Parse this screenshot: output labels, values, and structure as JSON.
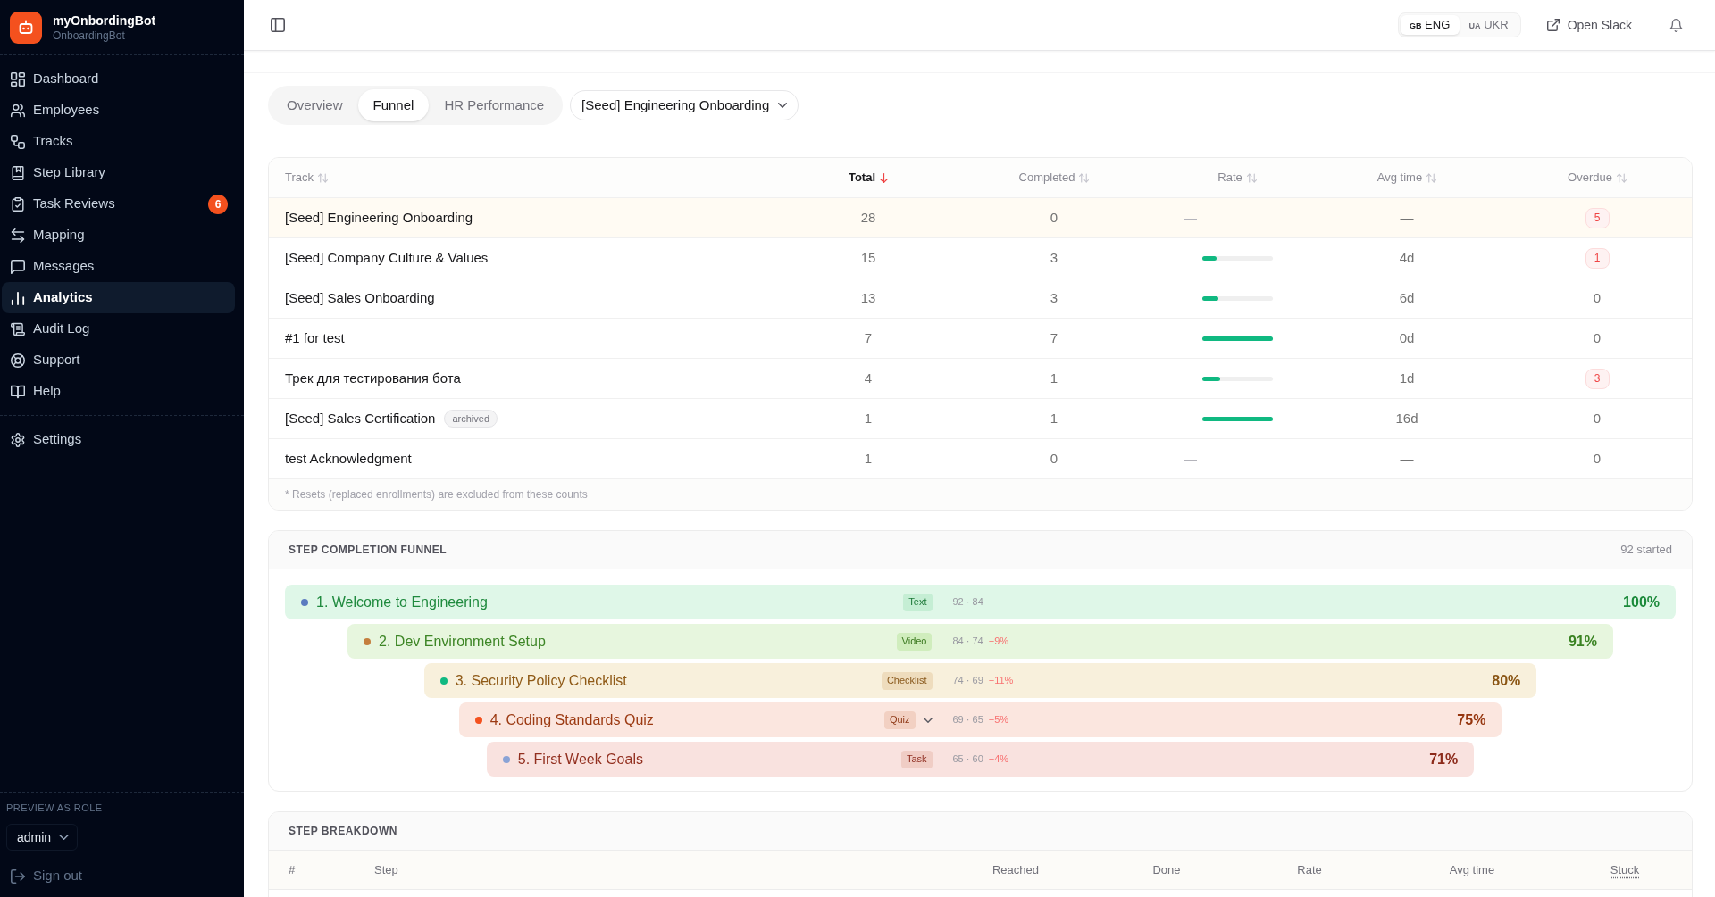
{
  "sidebar": {
    "brand": {
      "name": "myOnbordingBot",
      "subtitle": "OnboardingBot"
    },
    "nav": [
      {
        "label": "Dashboard",
        "selected": false
      },
      {
        "label": "Employees",
        "selected": false
      },
      {
        "label": "Tracks",
        "selected": false
      },
      {
        "label": "Step Library",
        "selected": false
      },
      {
        "label": "Task Reviews",
        "selected": false,
        "badge": "6"
      },
      {
        "label": "Mapping",
        "selected": false
      },
      {
        "label": "Messages",
        "selected": false
      },
      {
        "label": "Analytics",
        "selected": true
      },
      {
        "label": "Audit Log",
        "selected": false
      },
      {
        "label": "Support",
        "selected": false
      },
      {
        "label": "Help",
        "selected": false
      }
    ],
    "secondary_nav": [
      {
        "label": "Settings",
        "selected": false
      }
    ],
    "role_preview": {
      "label": "PREVIEW AS ROLE",
      "value": "admin"
    },
    "sign_out": "Sign out"
  },
  "topbar": {
    "languages": [
      {
        "code": "GB",
        "label": "ENG",
        "selected": true
      },
      {
        "code": "UA",
        "label": "UKR",
        "selected": false
      }
    ],
    "open_slack": "Open Slack"
  },
  "view_tabs": [
    {
      "label": "Overview",
      "selected": false
    },
    {
      "label": "Funnel",
      "selected": true
    },
    {
      "label": "HR Performance",
      "selected": false
    }
  ],
  "track_select": {
    "value": "[Seed] Engineering Onboarding"
  },
  "tracks_table": {
    "columns": [
      {
        "label": "Track",
        "sorted": false
      },
      {
        "label": "Total",
        "sorted": true
      },
      {
        "label": "Completed",
        "sorted": false
      },
      {
        "label": "Rate",
        "sorted": false
      },
      {
        "label": "Avg time",
        "sorted": false
      },
      {
        "label": "Overdue",
        "sorted": false
      }
    ],
    "rows": [
      {
        "track": "[Seed] Engineering Onboarding",
        "selected": true,
        "total": "28",
        "completed": "0",
        "rate": {
          "kind": "none",
          "text": "—"
        },
        "avg_time": "—",
        "overdue": "5",
        "overdue_flagged": true
      },
      {
        "track": "[Seed] Company Culture & Values",
        "selected": false,
        "total": "15",
        "completed": "3",
        "rate": {
          "kind": "bar",
          "level": 0.2
        },
        "avg_time": "4d",
        "overdue": "1",
        "overdue_flagged": true
      },
      {
        "track": "[Seed] Sales Onboarding",
        "selected": false,
        "total": "13",
        "completed": "3",
        "rate": {
          "kind": "bar",
          "level": 0.23
        },
        "avg_time": "6d",
        "overdue": "0",
        "overdue_flagged": false
      },
      {
        "track": "#1 for test",
        "selected": false,
        "total": "7",
        "completed": "7",
        "rate": {
          "kind": "bar",
          "level": 1
        },
        "avg_time": "0d",
        "overdue": "0",
        "overdue_flagged": false
      },
      {
        "track": "Трек для тестирования бота",
        "selected": false,
        "total": "4",
        "completed": "1",
        "rate": {
          "kind": "bar",
          "level": 0.25
        },
        "avg_time": "1d",
        "overdue": "3",
        "overdue_flagged": true
      },
      {
        "track": "[Seed] Sales Certification",
        "tag": "archived",
        "selected": false,
        "total": "1",
        "completed": "1",
        "rate": {
          "kind": "bar",
          "level": 1
        },
        "avg_time": "16d",
        "overdue": "0",
        "overdue_flagged": false
      },
      {
        "track": "test Acknowledgment",
        "selected": false,
        "total": "1",
        "completed": "0",
        "rate": {
          "kind": "none",
          "text": "—"
        },
        "avg_time": "—",
        "overdue": "0",
        "overdue_flagged": false
      }
    ],
    "footnote": "* Resets (replaced enrollments) are excluded from these counts"
  },
  "funnel": {
    "title": "STEP COMPLETION FUNNEL",
    "started": "92 started",
    "steps": [
      {
        "label": "1. Welcome to Engineering",
        "color": "#5b7bc0",
        "type": "Text",
        "expandable": false,
        "counts": "92 · 84",
        "percent": "100%"
      },
      {
        "label": "2. Dev Environment Setup",
        "color": "#c47f3e",
        "type": "Video",
        "expandable": false,
        "counts": "84 · 74",
        "change": "−9%",
        "percent": "91%"
      },
      {
        "label": "3. Security Policy Checklist",
        "color": "#10b981",
        "type": "Checklist",
        "expandable": false,
        "counts": "74 · 69",
        "change": "−11%",
        "percent": "80%"
      },
      {
        "label": "4. Coding Standards Quiz",
        "color": "#f4511e",
        "type": "Quiz",
        "expandable": true,
        "counts": "69 · 65",
        "change": "−5%",
        "percent": "75%"
      },
      {
        "label": "5. First Week Goals",
        "color": "#8aa3d6",
        "type": "Task",
        "expandable": false,
        "counts": "65 · 60",
        "change": "−4%",
        "percent": "71%"
      }
    ]
  },
  "breakdown": {
    "title": "STEP BREAKDOWN",
    "columns": [
      {
        "label": "#",
        "hint": false
      },
      {
        "label": "Step",
        "hint": false
      },
      {
        "label": "Reached",
        "hint": false
      },
      {
        "label": "Done",
        "hint": false
      },
      {
        "label": "Rate",
        "hint": false
      },
      {
        "label": "Avg time",
        "hint": false
      },
      {
        "label": "Stuck",
        "hint": true
      }
    ]
  }
}
